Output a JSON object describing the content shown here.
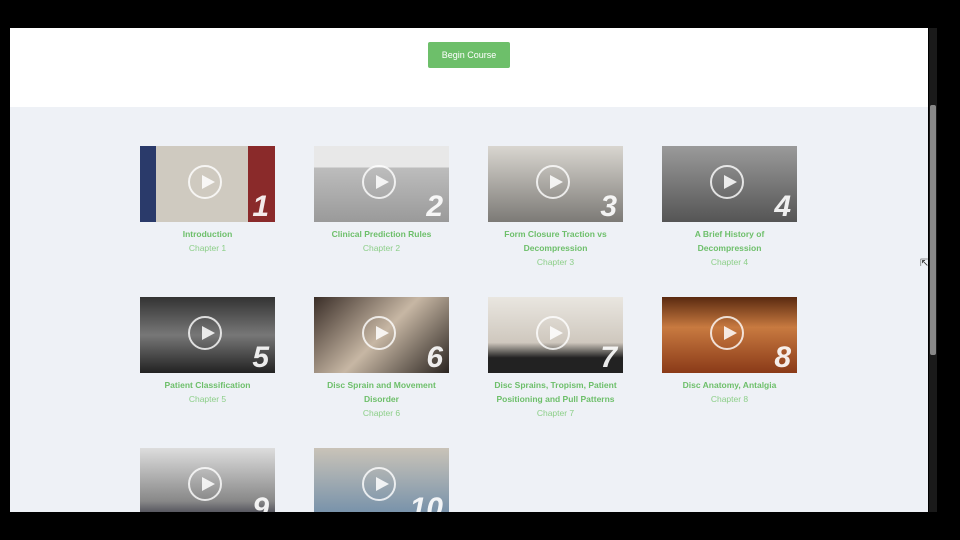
{
  "header": {
    "begin_label": "Begin Course"
  },
  "chapters": [
    {
      "title": "Introduction",
      "chapter": "Chapter 1",
      "num": "1",
      "bg": "linear-gradient(90deg,#2a3a6a 0 12%,#cfcac0 12% 80%,#8a2a2a 80%)"
    },
    {
      "title": "Clinical Prediction Rules",
      "chapter": "Chapter 2",
      "num": "2",
      "bg": "linear-gradient(180deg,#e8e8e8 0 28%,#bdbdbd 28%,#9a9a9a)"
    },
    {
      "title": "Form Closure Traction vs Decompression",
      "chapter": "Chapter 3",
      "num": "3",
      "bg": "linear-gradient(180deg,#d9d6d0,#7c7a76)"
    },
    {
      "title": "A Brief History of Decompression",
      "chapter": "Chapter 4",
      "num": "4",
      "bg": "linear-gradient(180deg,#9a9a9a,#555)"
    },
    {
      "title": "Patient Classification",
      "chapter": "Chapter 5",
      "num": "5",
      "bg": "linear-gradient(180deg,#333,#777 50%,#222)"
    },
    {
      "title": "Disc Sprain and Movement Disorder",
      "chapter": "Chapter 6",
      "num": "6",
      "bg": "linear-gradient(135deg,#3a2e28,#c7b7a4 50%,#2a2420)"
    },
    {
      "title": "Disc Sprains, Tropism, Patient Positioning and Pull Patterns",
      "chapter": "Chapter 7",
      "num": "7",
      "bg": "linear-gradient(180deg,#e9e6e0,#cfc8be 60%,#222 80%)"
    },
    {
      "title": "Disc Anatomy, Antalgia",
      "chapter": "Chapter 8",
      "num": "8",
      "bg": "linear-gradient(180deg,#5a2a10,#c87a40 40%,#8a3a18)"
    },
    {
      "title": "",
      "chapter": "",
      "num": "9",
      "bg": "linear-gradient(180deg,#ddd,#888 70%,#223)"
    },
    {
      "title": "",
      "chapter": "",
      "num": "10",
      "bg": "linear-gradient(180deg,#c9c3b8,#6a8aa8)"
    }
  ]
}
